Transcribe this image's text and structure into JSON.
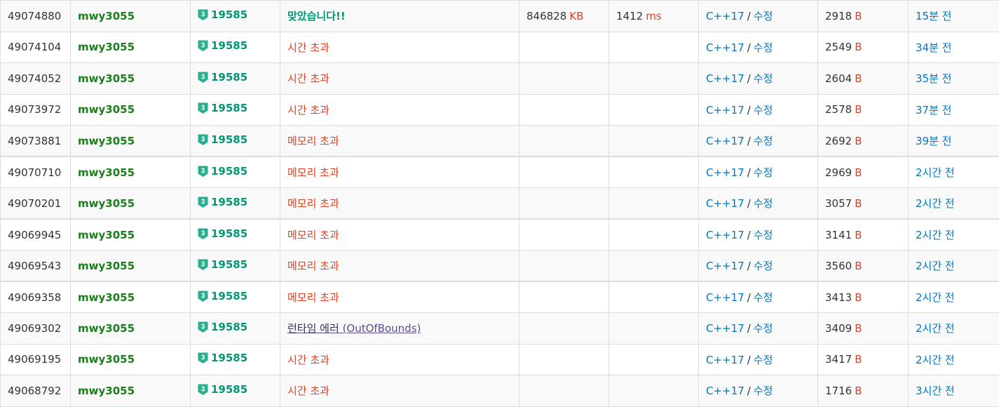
{
  "colors": {
    "accepted": "#009874",
    "error": "#dd4124",
    "link": "#0076c0",
    "username": "#1a7f1a",
    "tier_badge": "#27ae8e"
  },
  "table": {
    "separator_label": "/",
    "rows": [
      {
        "id": "49074880",
        "user": "mwy3055",
        "tier": "3",
        "problem": "19585",
        "result": "맞았습니다!!",
        "result_kind": "ac",
        "memory": "846828",
        "memory_unit": "KB",
        "time": "1412",
        "time_unit": "ms",
        "lang": "C++17",
        "edit": "수정",
        "length": "2918",
        "length_unit": "B",
        "date": "15분 전"
      },
      {
        "id": "49074104",
        "user": "mwy3055",
        "tier": "3",
        "problem": "19585",
        "result": "시간 초과",
        "result_kind": "bad",
        "memory": "",
        "memory_unit": "",
        "time": "",
        "time_unit": "",
        "lang": "C++17",
        "edit": "수정",
        "length": "2549",
        "length_unit": "B",
        "date": "34분 전"
      },
      {
        "id": "49074052",
        "user": "mwy3055",
        "tier": "3",
        "problem": "19585",
        "result": "시간 초과",
        "result_kind": "bad",
        "memory": "",
        "memory_unit": "",
        "time": "",
        "time_unit": "",
        "lang": "C++17",
        "edit": "수정",
        "length": "2604",
        "length_unit": "B",
        "date": "35분 전"
      },
      {
        "id": "49073972",
        "user": "mwy3055",
        "tier": "3",
        "problem": "19585",
        "result": "시간 초과",
        "result_kind": "bad",
        "memory": "",
        "memory_unit": "",
        "time": "",
        "time_unit": "",
        "lang": "C++17",
        "edit": "수정",
        "length": "2578",
        "length_unit": "B",
        "date": "37분 전"
      },
      {
        "id": "49073881",
        "user": "mwy3055",
        "tier": "3",
        "problem": "19585",
        "result": "메모리 초과",
        "result_kind": "bad",
        "memory": "",
        "memory_unit": "",
        "time": "",
        "time_unit": "",
        "lang": "C++17",
        "edit": "수정",
        "length": "2692",
        "length_unit": "B",
        "date": "39분 전"
      },
      {
        "id": "49070710",
        "user": "mwy3055",
        "tier": "3",
        "problem": "19585",
        "result": "메모리 초과",
        "result_kind": "bad",
        "memory": "",
        "memory_unit": "",
        "time": "",
        "time_unit": "",
        "lang": "C++17",
        "edit": "수정",
        "length": "2969",
        "length_unit": "B",
        "date": "2시간 전"
      },
      {
        "id": "49070201",
        "user": "mwy3055",
        "tier": "3",
        "problem": "19585",
        "result": "메모리 초과",
        "result_kind": "bad",
        "memory": "",
        "memory_unit": "",
        "time": "",
        "time_unit": "",
        "lang": "C++17",
        "edit": "수정",
        "length": "3057",
        "length_unit": "B",
        "date": "2시간 전"
      },
      {
        "id": "49069945",
        "user": "mwy3055",
        "tier": "3",
        "problem": "19585",
        "result": "메모리 초과",
        "result_kind": "bad",
        "memory": "",
        "memory_unit": "",
        "time": "",
        "time_unit": "",
        "lang": "C++17",
        "edit": "수정",
        "length": "3141",
        "length_unit": "B",
        "date": "2시간 전"
      },
      {
        "id": "49069543",
        "user": "mwy3055",
        "tier": "3",
        "problem": "19585",
        "result": "메모리 초과",
        "result_kind": "bad",
        "memory": "",
        "memory_unit": "",
        "time": "",
        "time_unit": "",
        "lang": "C++17",
        "edit": "수정",
        "length": "3560",
        "length_unit": "B",
        "date": "2시간 전"
      },
      {
        "id": "49069358",
        "user": "mwy3055",
        "tier": "3",
        "problem": "19585",
        "result": "메모리 초과",
        "result_kind": "bad",
        "memory": "",
        "memory_unit": "",
        "time": "",
        "time_unit": "",
        "lang": "C++17",
        "edit": "수정",
        "length": "3413",
        "length_unit": "B",
        "date": "2시간 전"
      },
      {
        "id": "49069302",
        "user": "mwy3055",
        "tier": "3",
        "problem": "19585",
        "result": "런타임 에러",
        "result_detail": "(OutOfBounds)",
        "result_kind": "rte",
        "memory": "",
        "memory_unit": "",
        "time": "",
        "time_unit": "",
        "lang": "C++17",
        "edit": "수정",
        "length": "3409",
        "length_unit": "B",
        "date": "2시간 전"
      },
      {
        "id": "49069195",
        "user": "mwy3055",
        "tier": "3",
        "problem": "19585",
        "result": "시간 초과",
        "result_kind": "bad",
        "memory": "",
        "memory_unit": "",
        "time": "",
        "time_unit": "",
        "lang": "C++17",
        "edit": "수정",
        "length": "3417",
        "length_unit": "B",
        "date": "2시간 전"
      },
      {
        "id": "49068792",
        "user": "mwy3055",
        "tier": "3",
        "problem": "19585",
        "result": "시간 초과",
        "result_kind": "bad",
        "memory": "",
        "memory_unit": "",
        "time": "",
        "time_unit": "",
        "lang": "C++17",
        "edit": "수정",
        "length": "1716",
        "length_unit": "B",
        "date": "3시간 전"
      }
    ]
  }
}
